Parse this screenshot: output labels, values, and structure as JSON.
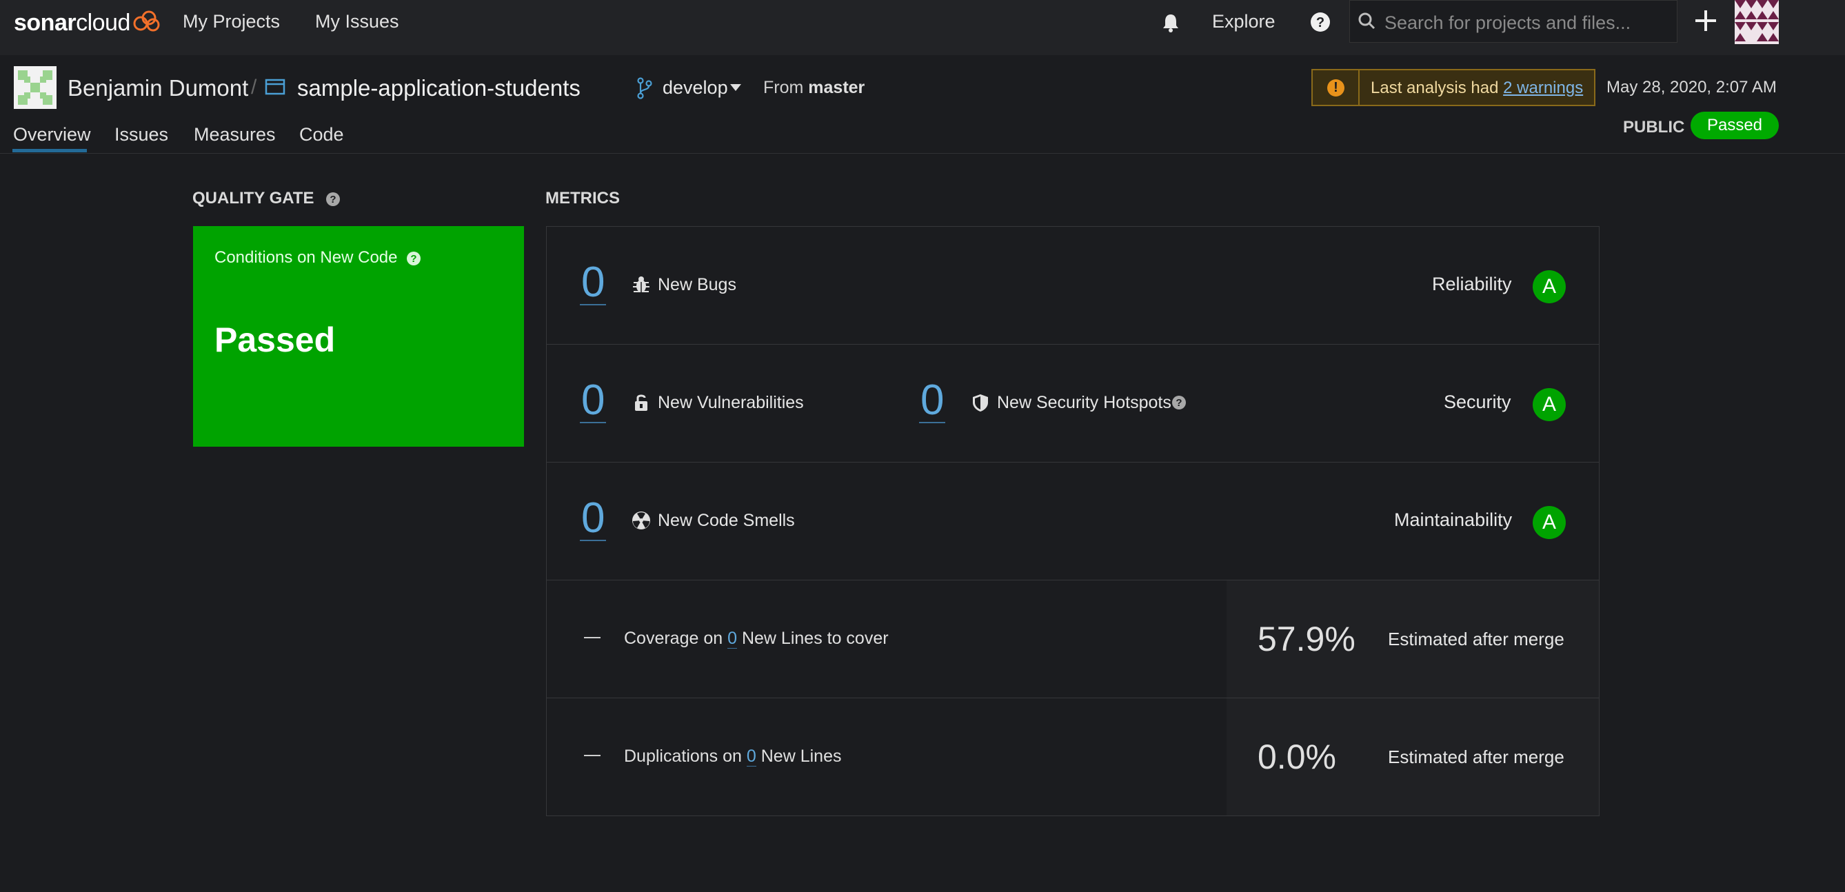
{
  "nav": {
    "logo_bold": "sonar",
    "logo_light": "cloud",
    "links": [
      "My Projects",
      "My Issues"
    ],
    "explore": "Explore",
    "search_placeholder": "Search for projects and files..."
  },
  "project": {
    "organization": "Benjamin Dumont",
    "separator": "/",
    "name": "sample-application-students",
    "branch": "develop",
    "from_prefix": "From",
    "from_branch": "master",
    "warning_text": "Last analysis had",
    "warning_link": "2 warnings",
    "analysis_date": "May 28, 2020, 2:07 AM",
    "visibility": "PUBLIC",
    "status": "Passed"
  },
  "tabs": [
    "Overview",
    "Issues",
    "Measures",
    "Code"
  ],
  "quality_gate": {
    "title": "QUALITY GATE",
    "subtitle": "Conditions on New Code",
    "status": "Passed"
  },
  "metrics": {
    "title": "METRICS",
    "reliability": {
      "value": "0",
      "label": "New Bugs",
      "category": "Reliability",
      "rating": "A"
    },
    "security": {
      "vuln_value": "0",
      "vuln_label": "New Vulnerabilities",
      "hotspot_value": "0",
      "hotspot_label": "New Security Hotspots",
      "category": "Security",
      "rating": "A"
    },
    "maintainability": {
      "value": "0",
      "label": "New Code Smells",
      "category": "Maintainability",
      "rating": "A"
    },
    "coverage": {
      "dash": "—",
      "prefix": "Coverage on",
      "lines": "0",
      "suffix": "New Lines to cover",
      "estimate": "57.9%",
      "estimate_label": "Estimated after merge"
    },
    "duplications": {
      "dash": "—",
      "prefix": "Duplications on",
      "lines": "0",
      "suffix": "New Lines",
      "estimate": "0.0%",
      "estimate_label": "Estimated after merge"
    }
  },
  "colors": {
    "passed": "#00a300",
    "link": "#5fa9dd",
    "warning": "#e8921b",
    "background": "#1b1c1f"
  }
}
